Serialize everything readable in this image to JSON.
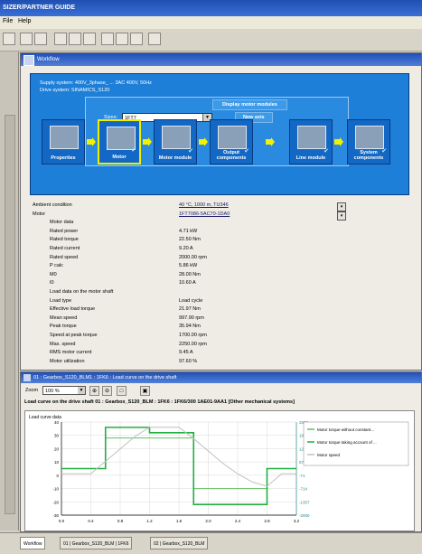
{
  "app": {
    "title": "SIZER/PARTNER GUIDE",
    "menu": [
      "File",
      "Help"
    ]
  },
  "main_window": {
    "title": "Workflow",
    "supply_system": "Supply system: 400V_3phase_ ... 3AC 400V, 50Hz",
    "drive_system": "Drive system: SINAMICS_S120",
    "drive_button": "Display motor modules",
    "size_label": "Sizes:",
    "size_value": "1FT7",
    "new_axis_button": "New axis",
    "steps": [
      {
        "label": "Properties"
      },
      {
        "label": "Motor"
      },
      {
        "label": "Motor module"
      },
      {
        "label": "Output components"
      },
      {
        "label": "Line module"
      },
      {
        "label": "System components"
      }
    ],
    "rows": [
      {
        "label": "Ambient condition",
        "value": "40 °C, 1000 m, TU346",
        "link": true,
        "level": 0
      },
      {
        "label": "Motor",
        "value": "1FT7086-5AC70-1DA0",
        "link": true,
        "level": 0
      },
      {
        "label": "Motor data",
        "value": "",
        "link": false,
        "level": 1
      },
      {
        "label": "Rated power",
        "value": "4.71 kW",
        "link": false,
        "level": 1
      },
      {
        "label": "Rated torque",
        "value": "22.50 Nm",
        "link": false,
        "level": 1
      },
      {
        "label": "Rated current",
        "value": "9.20 A",
        "link": false,
        "level": 1
      },
      {
        "label": "Rated speed",
        "value": "2000.00 rpm",
        "link": false,
        "level": 1
      },
      {
        "label": "P calc",
        "value": "5.86 kW",
        "link": false,
        "level": 1
      },
      {
        "label": "M0",
        "value": "28.00 Nm",
        "link": false,
        "level": 1
      },
      {
        "label": "I0",
        "value": "10.60 A",
        "link": false,
        "level": 1
      },
      {
        "label": "Load data on the motor shaft",
        "value": "",
        "link": false,
        "level": 1
      },
      {
        "label": "Load type",
        "value": "Load cycle",
        "link": false,
        "level": 1
      },
      {
        "label": "Effective load torque",
        "value": "21.97 Nm",
        "link": false,
        "level": 1
      },
      {
        "label": "Mean speed",
        "value": "997.90 rpm",
        "link": false,
        "level": 1
      },
      {
        "label": "Peak torque",
        "value": "35.94 Nm",
        "link": false,
        "level": 1
      },
      {
        "label": "Speed at peak torque",
        "value": "1700.00 rpm",
        "link": false,
        "level": 1
      },
      {
        "label": "Max. speed",
        "value": "2250.00 rpm",
        "link": false,
        "level": 1
      },
      {
        "label": "RMS motor current",
        "value": "9.45 A",
        "link": false,
        "level": 1
      },
      {
        "label": "Motor utilization",
        "value": "97.60 %",
        "link": false,
        "level": 1
      }
    ]
  },
  "chart_window": {
    "title": "01 : Gearbox_S120_BLM1 : 1FK6 : Load curve on the drive shaft",
    "zoom_label": "Zoom",
    "zoom_value": "100 %",
    "chart_title": "Load curve on the drive shaft 01 : Gearbox_S120_BLM : 1FK6 : 1FK6/300 1AE01-9AA1 [Other mechanical systems]",
    "y_label": "Load curve data"
  },
  "chart_data": {
    "type": "line",
    "x": [
      0,
      0.2,
      0.4,
      0.6,
      0.8,
      1.0,
      1.2,
      1.4,
      1.6,
      1.8,
      2.0,
      2.2,
      2.4,
      2.6,
      2.8,
      3.0,
      3.2
    ],
    "xlim": [
      0,
      3.2
    ],
    "ylim": [
      -30,
      40
    ],
    "y2lim": [
      -2000,
      2500
    ],
    "ylabel": "Load curve data",
    "legend": [
      "Motor torque without constant...",
      "Motor torque taking account of ...",
      "Motor speed"
    ],
    "series": [
      {
        "name": "Motor torque without constant...",
        "values": [
          5,
          5,
          5,
          28,
          28,
          28,
          28,
          28,
          28,
          -10,
          -10,
          -10,
          -10,
          -10,
          5,
          5,
          5
        ]
      },
      {
        "name": "Motor torque taking account of ...",
        "values": [
          5,
          5,
          5,
          36,
          36,
          36,
          32,
          32,
          32,
          -22,
          -22,
          -22,
          -22,
          -22,
          5,
          5,
          5
        ]
      },
      {
        "name": "Motor speed",
        "values": [
          0,
          0,
          0,
          600,
          1200,
          1800,
          2250,
          2250,
          2250,
          1700,
          1100,
          500,
          0,
          -400,
          -600,
          0,
          0
        ]
      }
    ],
    "colors": [
      "#60c060",
      "#20b040",
      "#c0c0c0"
    ],
    "grid": true,
    "legend_position": "right"
  },
  "status": {
    "tabs": [
      "Workflow",
      "01 | Gearbox_S120_BLM | 1FK6",
      "02 | Gearbox_S120_BLM"
    ]
  },
  "colors": {
    "title_bar": "#1f4fb0",
    "panel_blue": "#1d7fd8",
    "card_blue": "#1268c4",
    "selected_border": "#f0f000"
  }
}
